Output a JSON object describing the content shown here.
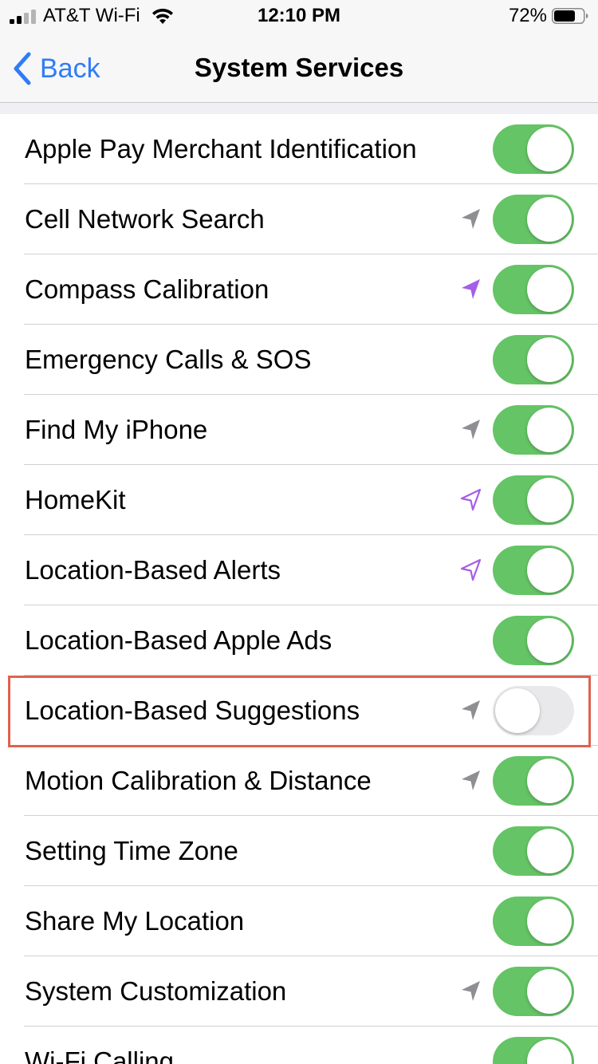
{
  "status_bar": {
    "carrier": "AT&T Wi-Fi",
    "time": "12:10 PM",
    "battery_percent": "72%",
    "battery_level": 0.72,
    "signal_icon": "cellular-signal-icon",
    "wifi_icon": "wifi-icon",
    "battery_icon": "battery-icon"
  },
  "nav": {
    "back_label": "Back",
    "title": "System Services",
    "back_icon": "chevron-left-icon"
  },
  "colors": {
    "accent_blue": "#2f7cf6",
    "toggle_on": "#65c466",
    "toggle_off": "#e9e9eb",
    "location_gray": "#8e8e93",
    "location_purple": "#a55ee8",
    "highlight_red": "#e0624f"
  },
  "rows": [
    {
      "label": "Apple Pay Merchant Identification",
      "on": true,
      "icon": "none"
    },
    {
      "label": "Cell Network Search",
      "on": true,
      "icon": "location-arrow-gray-icon"
    },
    {
      "label": "Compass Calibration",
      "on": true,
      "icon": "location-arrow-purple-icon"
    },
    {
      "label": "Emergency Calls & SOS",
      "on": true,
      "icon": "none"
    },
    {
      "label": "Find My iPhone",
      "on": true,
      "icon": "location-arrow-gray-icon"
    },
    {
      "label": "HomeKit",
      "on": true,
      "icon": "location-arrow-outline-purple-icon"
    },
    {
      "label": "Location-Based Alerts",
      "on": true,
      "icon": "location-arrow-outline-purple-icon"
    },
    {
      "label": "Location-Based Apple Ads",
      "on": true,
      "icon": "none"
    },
    {
      "label": "Location-Based Suggestions",
      "on": false,
      "icon": "location-arrow-gray-icon",
      "highlighted": true
    },
    {
      "label": "Motion Calibration & Distance",
      "on": true,
      "icon": "location-arrow-gray-icon"
    },
    {
      "label": "Setting Time Zone",
      "on": true,
      "icon": "none"
    },
    {
      "label": "Share My Location",
      "on": true,
      "icon": "none"
    },
    {
      "label": "System Customization",
      "on": true,
      "icon": "location-arrow-gray-icon"
    },
    {
      "label": "Wi-Fi Calling",
      "on": true,
      "icon": "none"
    }
  ]
}
